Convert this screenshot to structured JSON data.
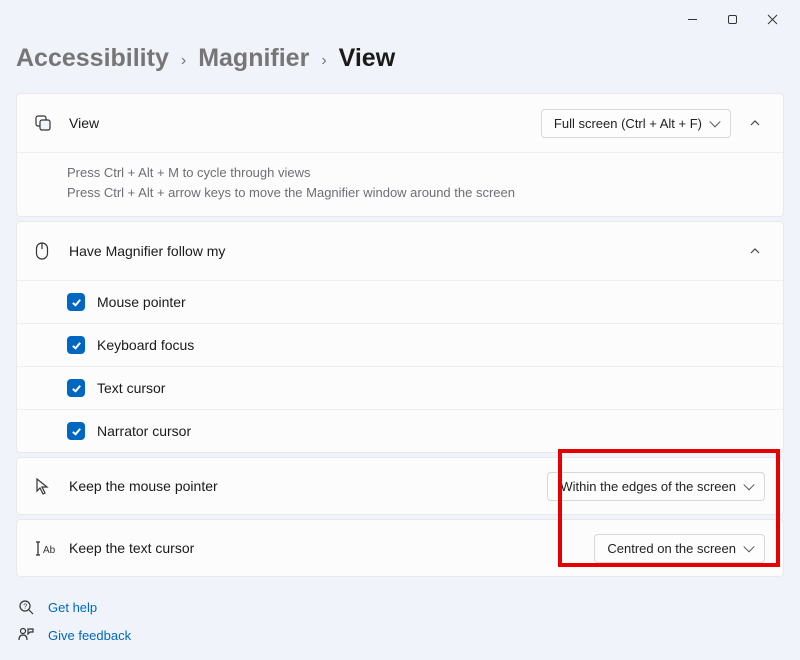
{
  "breadcrumb": {
    "accessibility": "Accessibility",
    "magnifier": "Magnifier",
    "view": "View"
  },
  "view_card": {
    "label": "View",
    "dropdown": "Full screen (Ctrl + Alt + F)",
    "tip1": "Press Ctrl + Alt + M to cycle through views",
    "tip2": "Press Ctrl + Alt + arrow keys to move the Magnifier window around the screen"
  },
  "follow_card": {
    "label": "Have Magnifier follow my",
    "items": {
      "0": {
        "label": "Mouse pointer"
      },
      "1": {
        "label": "Keyboard focus"
      },
      "2": {
        "label": "Text cursor"
      },
      "3": {
        "label": "Narrator cursor"
      }
    }
  },
  "mouse_card": {
    "label": "Keep the mouse pointer",
    "dropdown": "Within the edges of the screen"
  },
  "text_card": {
    "label": "Keep the text cursor",
    "dropdown": "Centred on the screen"
  },
  "links": {
    "help": "Get help",
    "feedback": "Give feedback"
  }
}
